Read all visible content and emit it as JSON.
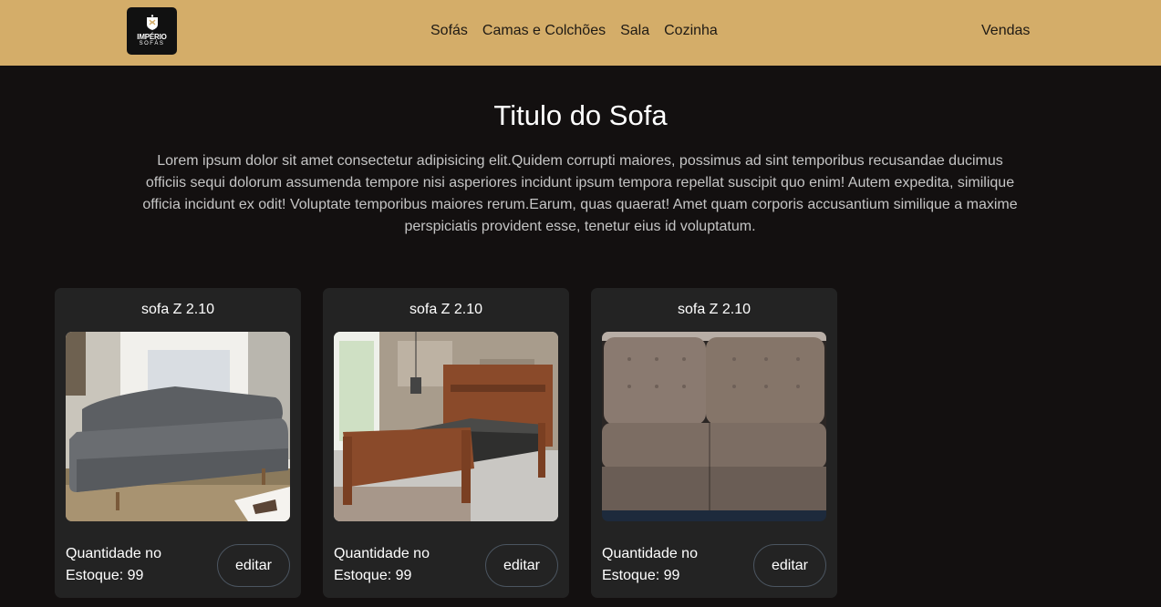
{
  "brand": {
    "logo_line1": "IMPÉRIO",
    "logo_line2": "SOFÁS"
  },
  "nav": {
    "links": [
      "Sofás",
      "Camas e Colchões",
      "Sala",
      "Cozinha"
    ],
    "right_link": "Vendas"
  },
  "main": {
    "title": "Titulo do Sofa",
    "description": "Lorem ipsum dolor sit amet consectetur adipisicing elit.Quidem corrupti maiores, possimus ad sint temporibus recusandae ducimus officiis sequi dolorum assumenda tempore nisi asperiores incidunt ipsum tempora repellat suscipit quo enim! Autem expedita, similique officia incidunt ex odit! Voluptate temporibus maiores rerum.Earum, quas quaerat! Amet quam corporis accusantium similique a maxime perspiciatis provident esse, tenetur eius id voluptatum."
  },
  "products": [
    {
      "title": "sofa Z 2.10",
      "stock_text": "Quantidade no Estoque: 99",
      "button_label": "editar",
      "image": "gray-sofa-photo"
    },
    {
      "title": "sofa Z 2.10",
      "stock_text": "Quantidade no Estoque: 99",
      "button_label": "editar",
      "image": "wooden-bed-photo"
    },
    {
      "title": "sofa Z 2.10",
      "stock_text": "Quantidade no Estoque: 99",
      "button_label": "editar",
      "image": "brown-sofa-photo"
    }
  ],
  "colors": {
    "navbar": "#d4ad69",
    "background": "#131010",
    "card": "#232323",
    "button_border": "#4b5560"
  }
}
